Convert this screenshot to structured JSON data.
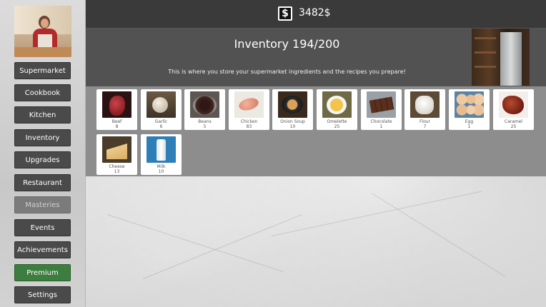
{
  "money": {
    "amount": "3482$",
    "icon": "dollar-icon"
  },
  "header": {
    "title": "Inventory 194/200",
    "subtitle": "This is where you store your supermarket ingredients and the recipes you prepare!"
  },
  "sidebar": {
    "items": [
      {
        "label": "Supermarket",
        "state": "normal"
      },
      {
        "label": "Cookbook",
        "state": "normal"
      },
      {
        "label": "Kitchen",
        "state": "normal"
      },
      {
        "label": "Inventory",
        "state": "normal"
      },
      {
        "label": "Upgrades",
        "state": "normal"
      },
      {
        "label": "Restaurant",
        "state": "normal"
      },
      {
        "label": "Masteries",
        "state": "disabled"
      },
      {
        "label": "Events",
        "state": "normal"
      },
      {
        "label": "Achievements",
        "state": "normal"
      },
      {
        "label": "Premium",
        "state": "premium"
      },
      {
        "label": "Settings",
        "state": "normal"
      }
    ]
  },
  "inventory": {
    "items": [
      {
        "name": "Beef",
        "count": "8"
      },
      {
        "name": "Garlic",
        "count": "6"
      },
      {
        "name": "Beans",
        "count": "5"
      },
      {
        "name": "Chicken",
        "count": "83"
      },
      {
        "name": "Onion Soup",
        "count": "10"
      },
      {
        "name": "Omelette",
        "count": "25"
      },
      {
        "name": "Chocolate",
        "count": "1"
      },
      {
        "name": "Flour",
        "count": "7"
      },
      {
        "name": "Egg",
        "count": "1"
      },
      {
        "name": "Caramel",
        "count": "25"
      },
      {
        "name": "Cheese",
        "count": "13"
      },
      {
        "name": "Milk",
        "count": "10"
      }
    ]
  },
  "colors": {
    "topbar": "#3a3a3a",
    "header": "#525252",
    "panel": "#8d8d8d",
    "button": "#4a4a4a",
    "button_disabled": "#7b7b7b",
    "premium": "#3d7d3f"
  }
}
